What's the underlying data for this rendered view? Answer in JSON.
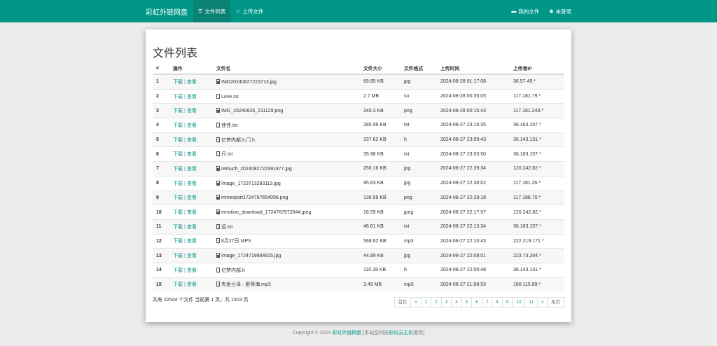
{
  "nav": {
    "brand": "彩虹外链网盘",
    "file_list": "文件列表",
    "upload": "上传文件",
    "my_files": "我的文件",
    "login": "未登录"
  },
  "page_title": "文件列表",
  "table": {
    "headers": [
      "#",
      "操作",
      "文件名",
      "文件大小",
      "文件格式",
      "上传时间",
      "上传者IP"
    ],
    "download_label": "下载",
    "view_label": "查看",
    "separator": "|",
    "rows": [
      {
        "no": "1",
        "name": "IMG20240827223713.jpg",
        "size": "69.85 KB",
        "fmt": "jpg",
        "time": "2024-08-28 01:17:08",
        "ip": "36.57.49.*",
        "icon": "image-file-icon"
      },
      {
        "no": "2",
        "name": "Love.so",
        "size": "2.7 MB",
        "fmt": "so",
        "time": "2024-08-28 00:35:05",
        "ip": "117.181.79.*",
        "icon": "file-icon"
      },
      {
        "no": "3",
        "name": "IMG_20240826_211129.png",
        "size": "340.3 KB",
        "fmt": "png",
        "time": "2024-08-28 00:15:43",
        "ip": "117.181.243.*",
        "icon": "image-file-icon"
      },
      {
        "no": "4",
        "name": "佳佳.txt",
        "size": "285.99 KB",
        "fmt": "txt",
        "time": "2024-08-27 23:16:35",
        "ip": "36.163.157.*",
        "icon": "text-file-icon"
      },
      {
        "no": "5",
        "name": "亿梦内部入门.h",
        "size": "337.62 KB",
        "fmt": "h",
        "time": "2024-08-27 23:09:43",
        "ip": "36.143.131.*",
        "icon": "text-file-icon"
      },
      {
        "no": "6",
        "name": "尺.txt",
        "size": "35.98 KB",
        "fmt": "txt",
        "time": "2024-08-27 23:03:50",
        "ip": "36.163.157.*",
        "icon": "text-file-icon"
      },
      {
        "no": "7",
        "name": "retouch_2024082722391877.jpg",
        "size": "250.16 KB",
        "fmt": "jpg",
        "time": "2024-08-27 22:39:34",
        "ip": "120.242.82.*",
        "icon": "image-file-icon"
      },
      {
        "no": "8",
        "name": "Image_1723713283113.jpg",
        "size": "95.63 KB",
        "fmt": "jpg",
        "time": "2024-08-27 22:38:02",
        "ip": "117.181.35.*",
        "icon": "image-file-icon"
      },
      {
        "no": "9",
        "name": "mmexport1724767654096.png",
        "size": "136.59 KB",
        "fmt": "png",
        "time": "2024-08-27 22:29:18",
        "ip": "117.188.70.*",
        "icon": "image-file-icon"
      },
      {
        "no": "10",
        "name": "emotion_download_1724767972644.jpeg",
        "size": "16.59 KB",
        "fmt": "jpeg",
        "time": "2024-08-27 22:17:57",
        "ip": "120.242.82.*",
        "icon": "image-file-icon"
      },
      {
        "no": "11",
        "name": "远.txt",
        "size": "46.61 KB",
        "fmt": "txt",
        "time": "2024-08-27 22:13:34",
        "ip": "36.163.157.*",
        "icon": "text-file-icon"
      },
      {
        "no": "12",
        "name": "8月27日.MP3",
        "size": "568.62 KB",
        "fmt": "mp3",
        "time": "2024-08-27 22:10:43",
        "ip": "222.219.171.*",
        "icon": "audio-file-icon"
      },
      {
        "no": "13",
        "name": "Image_1724719884815.jpg",
        "size": "44.89 KB",
        "fmt": "jpg",
        "time": "2024-08-27 22:08:01",
        "ip": "223.73.204.*",
        "icon": "image-file-icon"
      },
      {
        "no": "14",
        "name": "亿梦内部.h",
        "size": "110.28 KB",
        "fmt": "h",
        "time": "2024-08-27 22:00:48",
        "ip": "36.143.131.*",
        "icon": "text-file-icon"
      },
      {
        "no": "15",
        "name": "央金兰泽 - 爱琴海.mp3",
        "size": "3.49 MB",
        "fmt": "mp3",
        "time": "2024-08-27 21:58:53",
        "ip": "180.115.89.*",
        "icon": "audio-file-icon"
      }
    ]
  },
  "summary": "共有 22544 个文件  当前第 1 页，共 1503 页",
  "pagination": [
    "首页",
    "«",
    "1",
    "2",
    "3",
    "4",
    "5",
    "6",
    "7",
    "8",
    "9",
    "10",
    "11",
    "»",
    "尾页"
  ],
  "footer": {
    "prefix": "Copyright © 2024 ",
    "site_link": "彩虹外链网盘",
    "middle": " [本站空间由",
    "host_link": "彩虹云主机",
    "suffix": "提供]"
  },
  "colors": {
    "accent": "#009788",
    "format": "#1f3fd6"
  }
}
